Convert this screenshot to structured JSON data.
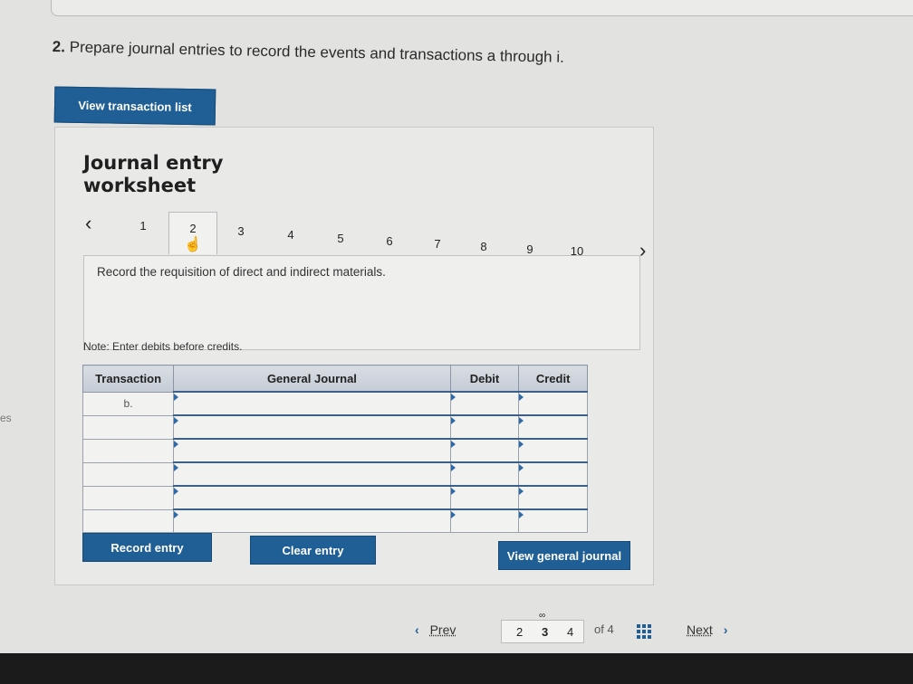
{
  "question": {
    "number": "2.",
    "text": "Prepare journal entries to record the events and transactions a through i."
  },
  "edge_text": "es",
  "view_transaction_label": "View transaction list",
  "worksheet": {
    "title_line1": "Journal entry",
    "title_line2": "worksheet",
    "tabs": [
      "1",
      "2",
      "3",
      "4",
      "5",
      "6",
      "7",
      "8",
      "9",
      "10"
    ],
    "active_tab": "2",
    "description": "Record the requisition of direct and indirect materials.",
    "note": "Note: Enter debits before credits."
  },
  "table": {
    "headers": {
      "transaction": "Transaction",
      "general_journal": "General Journal",
      "debit": "Debit",
      "credit": "Credit"
    },
    "rows": [
      {
        "transaction": "b.",
        "account": "",
        "debit": "",
        "credit": ""
      },
      {
        "transaction": "",
        "account": "",
        "debit": "",
        "credit": ""
      },
      {
        "transaction": "",
        "account": "",
        "debit": "",
        "credit": ""
      },
      {
        "transaction": "",
        "account": "",
        "debit": "",
        "credit": ""
      },
      {
        "transaction": "",
        "account": "",
        "debit": "",
        "credit": ""
      },
      {
        "transaction": "",
        "account": "",
        "debit": "",
        "credit": ""
      }
    ]
  },
  "buttons": {
    "record_entry": "Record entry",
    "clear_entry": "Clear entry",
    "view_general_journal": "View general journal"
  },
  "pagination": {
    "prev_label": "Prev",
    "pages": [
      "2",
      "3",
      "4"
    ],
    "current_page": "3",
    "of_text": "of 4",
    "next_label": "Next"
  },
  "colors": {
    "accent": "#1f5f96",
    "table_border": "#3b5f86"
  }
}
